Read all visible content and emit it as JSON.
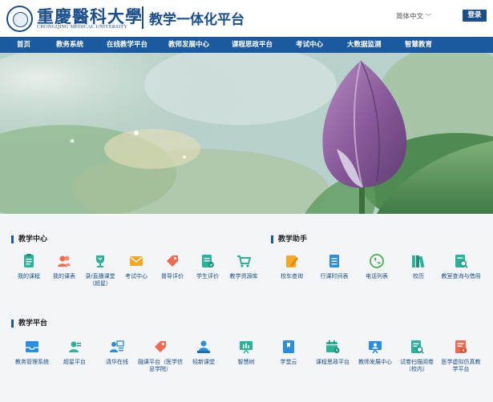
{
  "header": {
    "logo_cn": "重慶醫科大學",
    "logo_en": "CHONGQING MEDICAL UNIVERSITY",
    "platform_title": "教学一体化平台",
    "language": "简体中文",
    "login_label": "登录"
  },
  "nav": {
    "items": [
      "首页",
      "教务系统",
      "在线教学平台",
      "教师发展中心",
      "课程思政平台",
      "考试中心",
      "大数据监测",
      "智慧教育"
    ]
  },
  "sections": {
    "teaching_center": {
      "title": "教学中心",
      "items": [
        {
          "label": "我的课程",
          "icon": "doc-icon",
          "color": "#2bb39a"
        },
        {
          "label": "我的课表",
          "icon": "users-icon",
          "color": "#f06a4f"
        },
        {
          "label": "录/直播课堂（超星）",
          "icon": "trophy-icon",
          "color": "#2bb39a"
        },
        {
          "label": "考试中心",
          "icon": "mail-icon",
          "color": "#f5a623"
        },
        {
          "label": "督导评价",
          "icon": "tag-icon",
          "color": "#f06a4f"
        },
        {
          "label": "学生评价",
          "icon": "form-icon",
          "color": "#2bb39a"
        },
        {
          "label": "教学资源库",
          "icon": "cart-icon",
          "color": "#2bb39a"
        }
      ]
    },
    "teaching_assistant": {
      "title": "教学助手",
      "items": [
        {
          "label": "校车查询",
          "icon": "edit-icon",
          "color": "#f5a623"
        },
        {
          "label": "行课时间表",
          "icon": "list-icon",
          "color": "#2a8de0"
        },
        {
          "label": "电话列表",
          "icon": "phone-icon",
          "color": "#4caf50"
        },
        {
          "label": "校历",
          "icon": "books-icon",
          "color": "#2bb39a"
        },
        {
          "label": "教室查询与借用",
          "icon": "search-doc-icon",
          "color": "#2bb39a"
        }
      ]
    },
    "teaching_platform": {
      "title": "教学平台",
      "items": [
        {
          "label": "教务管理系统",
          "icon": "inbox-icon",
          "color": "#2a8de0"
        },
        {
          "label": "超星平台",
          "icon": "person-card-icon",
          "color": "#2bb39a"
        },
        {
          "label": "清华在线",
          "icon": "teacher-icon",
          "color": "#2a8de0"
        },
        {
          "label": "融课平台（医学信息学院）",
          "icon": "tag-icon",
          "color": "#f06a4f"
        },
        {
          "label": "轻新课堂",
          "icon": "class-icon",
          "color": "#2a8de0"
        },
        {
          "label": "智慧树",
          "icon": "board-icon",
          "color": "#2bb39a"
        },
        {
          "label": "学堂云",
          "icon": "book-icon",
          "color": "#2a8de0"
        },
        {
          "label": "课程思政平台",
          "icon": "calendar-icon",
          "color": "#2bb39a"
        },
        {
          "label": "教师发展中心",
          "icon": "screen-icon",
          "color": "#2a8de0"
        },
        {
          "label": "试卷扫描阅卷（校内）",
          "icon": "scan-icon",
          "color": "#2bb39a"
        },
        {
          "label": "医学虚拟仿真教学平台",
          "icon": "sim-icon",
          "color": "#f06a4f"
        }
      ]
    }
  }
}
